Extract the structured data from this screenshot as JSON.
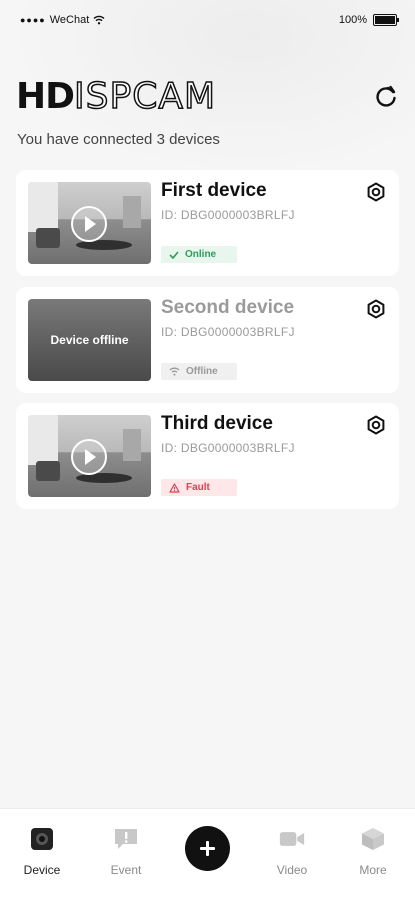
{
  "status_bar": {
    "signal": "●●●●",
    "carrier": "WeChat",
    "battery": "100%"
  },
  "header": {
    "logo_bold": "HD",
    "logo_outline": "ISPCAM",
    "subtitle": "You have connected 3 devices"
  },
  "devices": [
    {
      "name": "First device",
      "id": "ID: DBG0000003BRLFJ",
      "status": "Online",
      "overlay": ""
    },
    {
      "name": "Second device",
      "id": "ID: DBG0000003BRLFJ",
      "status": "Offline",
      "overlay": "Device offline"
    },
    {
      "name": "Third device",
      "id": "ID: DBG0000003BRLFJ",
      "status": "Fault",
      "overlay": ""
    }
  ],
  "tabs": [
    {
      "label": "Device",
      "icon": "camera-icon"
    },
    {
      "label": "Event",
      "icon": "alert-icon"
    },
    {
      "label": "Video",
      "icon": "video-icon"
    },
    {
      "label": "More",
      "icon": "cube-icon"
    }
  ],
  "colors": {
    "online": "#2e9c5b",
    "fault": "#e03f4e",
    "offline": "#9a9a9a",
    "accent": "#111111"
  }
}
